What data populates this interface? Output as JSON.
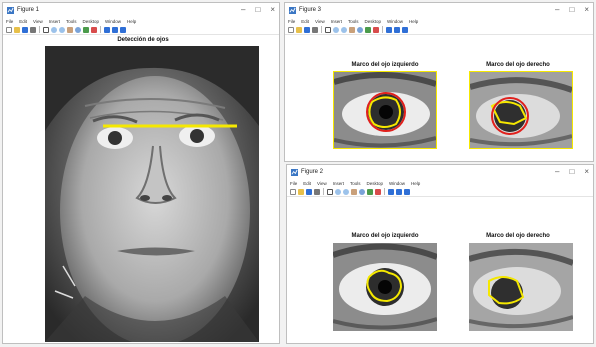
{
  "windows": {
    "figure1": {
      "title": "Figure 1",
      "menus": [
        "File",
        "Edit",
        "View",
        "Insert",
        "Tools",
        "Desktop",
        "Window",
        "Help"
      ],
      "plot_title": "Detección de ojos"
    },
    "figure3": {
      "title": "Figure 3",
      "menus": [
        "File",
        "Edit",
        "View",
        "Insert",
        "Tools",
        "Desktop",
        "Window",
        "Help"
      ],
      "left_title": "Marco del ojo izquierdo",
      "right_title": "Marco del ojo derecho"
    },
    "figure2": {
      "title": "Figure 2",
      "menus": [
        "File",
        "Edit",
        "View",
        "Insert",
        "Tools",
        "Desktop",
        "Window",
        "Help"
      ],
      "left_title": "Marco del ojo izquierdo",
      "right_title": "Marco del ojo derecho"
    }
  },
  "controls": {
    "minimize": "–",
    "maximize": "□",
    "close": "×"
  },
  "colors": {
    "highlight_yellow": "#f5e800",
    "circle_red": "#e0201c",
    "toolbar_blue": "#2f6fd6"
  },
  "icons": [
    "figure-app-icon",
    "new-icon",
    "open-icon",
    "save-icon",
    "print-icon",
    "pointer-icon",
    "zoom-in-icon",
    "zoom-out-icon",
    "pan-icon",
    "rotate-icon",
    "data-cursor-icon",
    "brush-icon",
    "colorbar-icon",
    "legend-icon",
    "plot-tools-icon"
  ]
}
